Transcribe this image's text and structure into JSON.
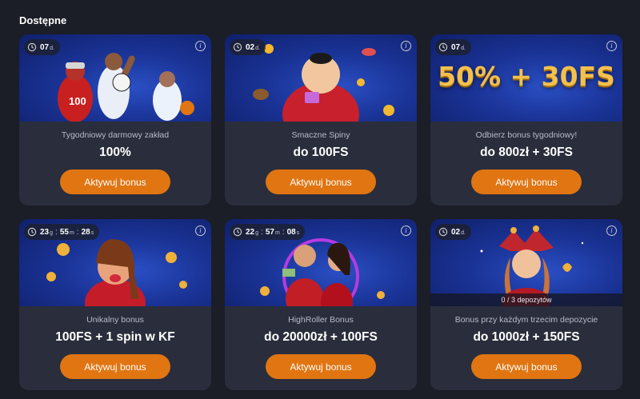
{
  "section_title": "Dostępne",
  "cards": [
    {
      "timer_parts": [
        {
          "value": "07",
          "unit": "d."
        }
      ],
      "subtitle": "Tygodniowy darmowy zakład",
      "amount": "100%",
      "button_label": "Aktywuj bonus",
      "art": "athletes"
    },
    {
      "timer_parts": [
        {
          "value": "02",
          "unit": "d."
        }
      ],
      "subtitle": "Smaczne Spiny",
      "amount": "do 100FS",
      "button_label": "Aktywuj bonus",
      "art": "sumo"
    },
    {
      "timer_parts": [
        {
          "value": "07",
          "unit": "d."
        }
      ],
      "subtitle": "Odbierz bonus tygodniowy!",
      "amount": "do 800zł + 30FS",
      "button_label": "Aktywuj bonus",
      "promo_text": "50% + 30FS",
      "art": "promo"
    },
    {
      "timer_parts": [
        {
          "value": "23",
          "unit": "g"
        },
        {
          "value": "55",
          "unit": "m"
        },
        {
          "value": "28",
          "unit": "s"
        }
      ],
      "subtitle": "Unikalny bonus",
      "amount": "100FS + 1 spin w KF",
      "button_label": "Aktywuj bonus",
      "art": "girl"
    },
    {
      "timer_parts": [
        {
          "value": "22",
          "unit": "g"
        },
        {
          "value": "57",
          "unit": "m"
        },
        {
          "value": "08",
          "unit": "s"
        }
      ],
      "subtitle": "HighRoller Bonus",
      "amount": "do 20000zł + 100FS",
      "button_label": "Aktywuj bonus",
      "art": "couple"
    },
    {
      "timer_parts": [
        {
          "value": "02",
          "unit": "d."
        }
      ],
      "subtitle": "Bonus przy każdym trzecim depozycie",
      "amount": "do 1000zł + 150FS",
      "button_label": "Aktywuj bonus",
      "progress_text": "0 / 3 depozytów",
      "art": "jester"
    }
  ],
  "colors": {
    "background": "#1b1d27",
    "card": "#2a2d3b",
    "accent": "#e07512",
    "banner": "#1a3396"
  },
  "icons": {
    "timer": "clock-icon",
    "info": "info-icon"
  }
}
